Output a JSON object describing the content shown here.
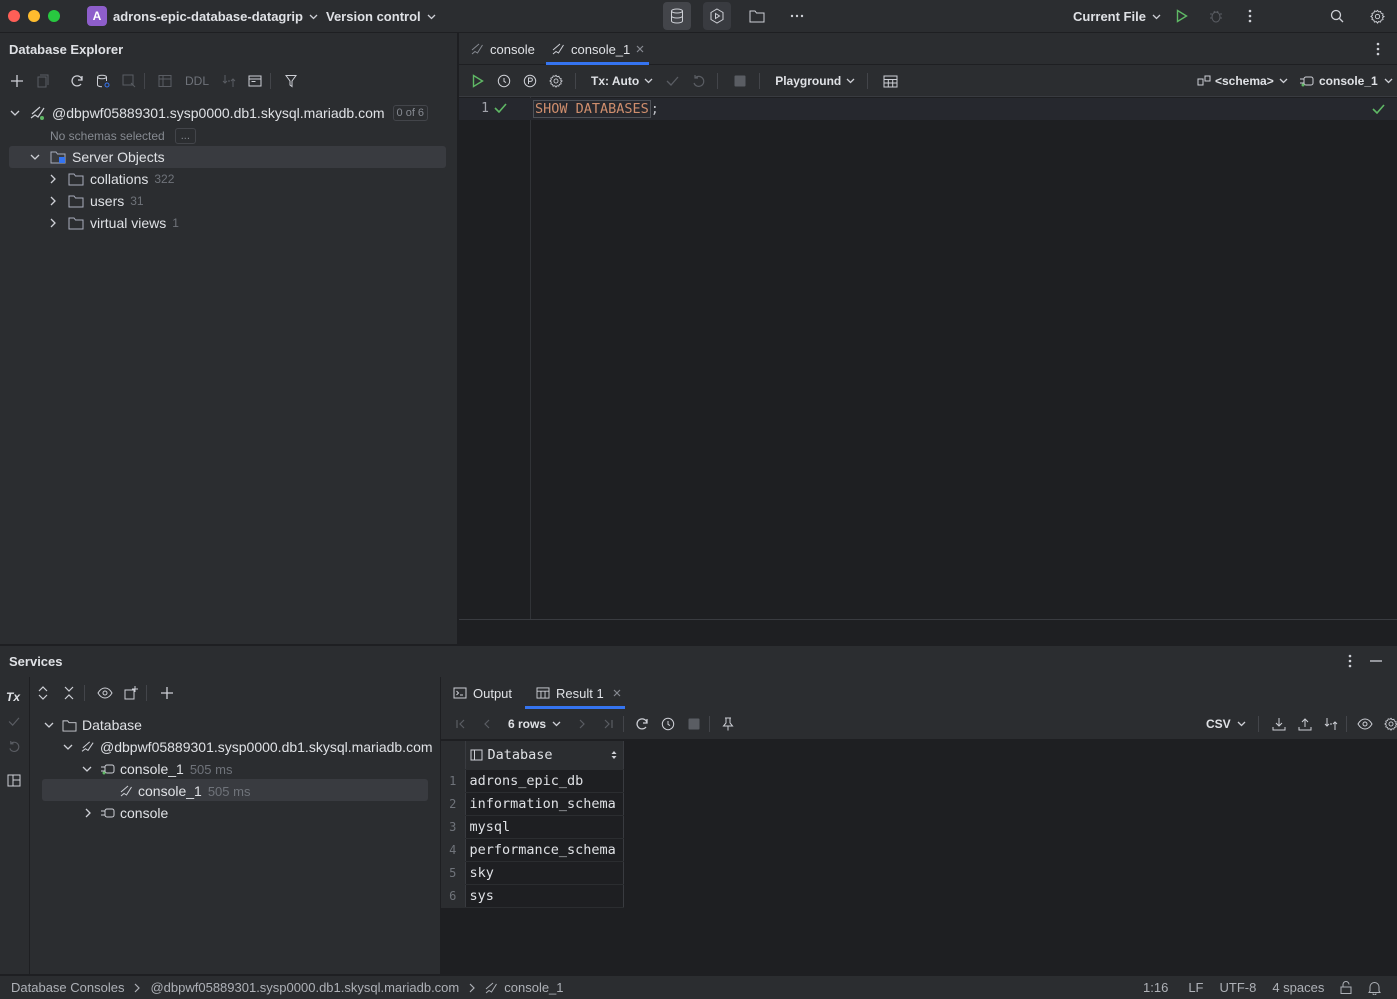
{
  "titlebar": {
    "project_initial": "A",
    "project_name": "adrons-epic-database-datagrip",
    "vcs_label": "Version control",
    "run_config": "Current File"
  },
  "db_explorer": {
    "title": "Database Explorer",
    "toolbar": {
      "ddl_label": "DDL"
    },
    "connection": {
      "name": "@dbpwf05889301.sysp0000.db1.skysql.mariadb.com",
      "badge": "0 of 6"
    },
    "no_schemas": "No schemas selected",
    "no_schemas_more": "...",
    "server_objects": "Server Objects",
    "items": [
      {
        "label": "collations",
        "count": "322"
      },
      {
        "label": "users",
        "count": "31"
      },
      {
        "label": "virtual views",
        "count": "1"
      }
    ]
  },
  "editor": {
    "tabs": [
      {
        "label": "console"
      },
      {
        "label": "console_1",
        "active": true
      }
    ],
    "toolbar": {
      "tx_label": "Tx: Auto",
      "playground_label": "Playground",
      "schema_label": "<schema>",
      "session_label": "console_1"
    },
    "line_number": "1",
    "code_keyword": "SHOW DATABASES",
    "code_rest": ";"
  },
  "services": {
    "title": "Services",
    "tx_label": "Tx",
    "tree": {
      "root": "Database",
      "connection": "@dbpwf05889301.sysp0000.db1.skysql.mariadb.com",
      "session": {
        "label": "console_1",
        "time": "505 ms"
      },
      "query": {
        "label": "console_1",
        "time": "505 ms"
      },
      "other_session": "console"
    },
    "results": {
      "tabs": [
        {
          "label": "Output"
        },
        {
          "label": "Result 1",
          "active": true
        }
      ],
      "rows_label": "6 rows",
      "export_format": "CSV",
      "column": "Database",
      "rows": [
        {
          "n": "1",
          "value": "adrons_epic_db"
        },
        {
          "n": "2",
          "value": "information_schema"
        },
        {
          "n": "3",
          "value": "mysql"
        },
        {
          "n": "4",
          "value": "performance_schema"
        },
        {
          "n": "5",
          "value": "sky"
        },
        {
          "n": "6",
          "value": "sys"
        }
      ]
    }
  },
  "statusbar": {
    "breadcrumb": [
      "Database Consoles",
      "@dbpwf05889301.sysp0000.db1.skysql.mariadb.com",
      "console_1"
    ],
    "position": "1:16",
    "line_sep": "LF",
    "encoding": "UTF-8",
    "indent": "4 spaces"
  },
  "colors": {
    "accent": "#3574f0",
    "keyword": "#cf8e6d",
    "success": "#5fb865",
    "avatar": "#8e5ecb",
    "selection": "#393b40"
  }
}
